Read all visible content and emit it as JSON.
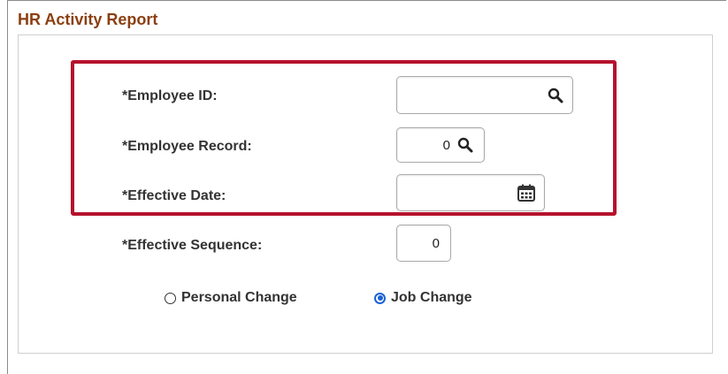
{
  "page": {
    "title": "HR Activity Report"
  },
  "form": {
    "employee_id": {
      "label": "*Employee ID:",
      "value": ""
    },
    "employee_record": {
      "label": "*Employee Record:",
      "value": "0"
    },
    "effective_date": {
      "label": "*Effective Date:",
      "value": ""
    },
    "effective_sequence": {
      "label": "*Effective Sequence:",
      "value": "0"
    }
  },
  "change_type": {
    "options": [
      {
        "label": "Personal Change",
        "selected": false
      },
      {
        "label": "Job Change",
        "selected": true
      }
    ]
  },
  "colors": {
    "title": "#8c3f12",
    "highlight_border": "#b5122c",
    "radio_selected": "#1a62d6"
  },
  "icons": {
    "lookup": "search-icon",
    "calendar": "calendar-icon"
  }
}
